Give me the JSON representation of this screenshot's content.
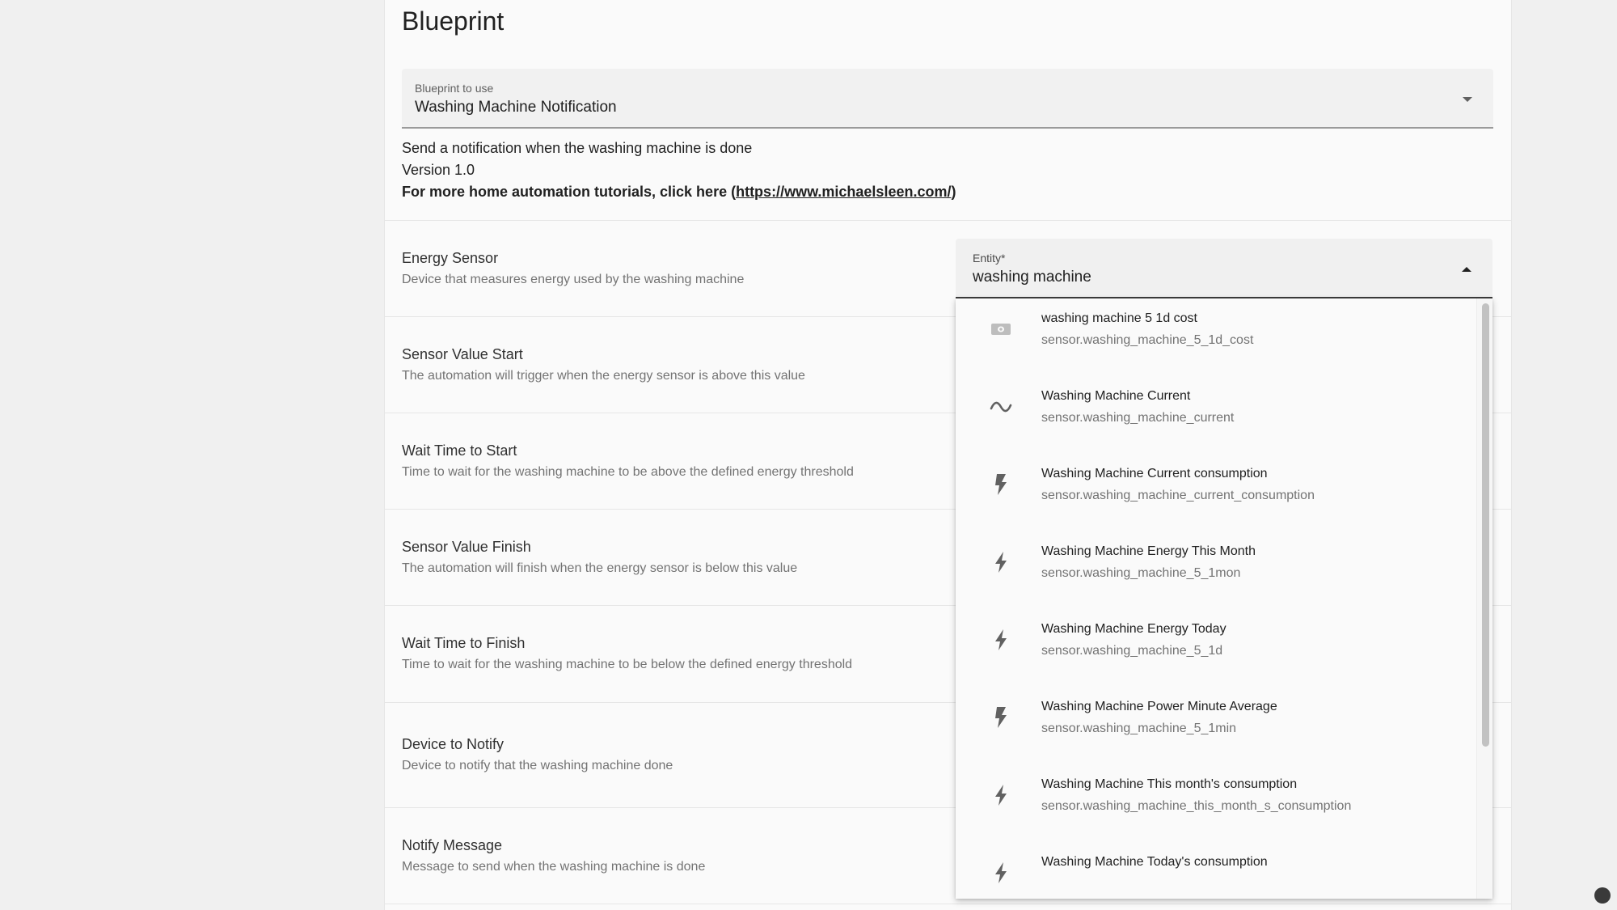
{
  "card": {
    "title": "Blueprint"
  },
  "blueprint_select": {
    "label": "Blueprint to use",
    "value": "Washing Machine Notification"
  },
  "description": {
    "line1": "Send a notification when the washing machine is done",
    "line2": "Version 1.0",
    "line3_prefix": "For more home automation tutorials, click here (",
    "link": "https://www.michaelsleen.com/",
    "line3_suffix": ")"
  },
  "inputs": [
    {
      "title": "Energy Sensor",
      "desc": "Device that measures energy used by the washing machine"
    },
    {
      "title": "Sensor Value Start",
      "desc": "The automation will trigger when the energy sensor is above this value"
    },
    {
      "title": "Wait Time to Start",
      "desc": "Time to wait for the washing machine to be above the defined energy threshold"
    },
    {
      "title": "Sensor Value Finish",
      "desc": "The automation will finish when the energy sensor is below this value"
    },
    {
      "title": "Wait Time to Finish",
      "desc": "Time to wait for the washing machine to be below the defined energy threshold"
    },
    {
      "title": "Device to Notify",
      "desc": "Device to notify that the washing machine done"
    },
    {
      "title": "Notify Message",
      "desc": "Message to send when the washing machine is done"
    }
  ],
  "entity_picker": {
    "label": "Entity*",
    "value": "washing machine",
    "options": [
      {
        "name": "washing machine 5 1d cost",
        "id": "sensor.washing_machine_5_1d_cost",
        "icon": "cash-icon"
      },
      {
        "name": "Washing Machine Current",
        "id": "sensor.washing_machine_current",
        "icon": "current-ac-icon"
      },
      {
        "name": "Washing Machine Current consumption",
        "id": "sensor.washing_machine_current_consumption",
        "icon": "flash-icon"
      },
      {
        "name": "Washing Machine Energy This Month",
        "id": "sensor.washing_machine_5_1mon",
        "icon": "flash-icon"
      },
      {
        "name": "Washing Machine Energy Today",
        "id": "sensor.washing_machine_5_1d",
        "icon": "flash-icon"
      },
      {
        "name": "Washing Machine Power Minute Average",
        "id": "sensor.washing_machine_5_1min",
        "icon": "flash-icon"
      },
      {
        "name": "Washing Machine This month's consumption",
        "id": "sensor.washing_machine_this_month_s_consumption",
        "icon": "flash-icon"
      },
      {
        "name": "Washing Machine Today's consumption",
        "id": "",
        "icon": "flash-icon"
      }
    ]
  },
  "colors": {
    "page_background": "#f0f0f0",
    "card_background": "#fafafa",
    "text_primary": "#212121",
    "text_secondary": "#737373",
    "icon": "#616161"
  }
}
